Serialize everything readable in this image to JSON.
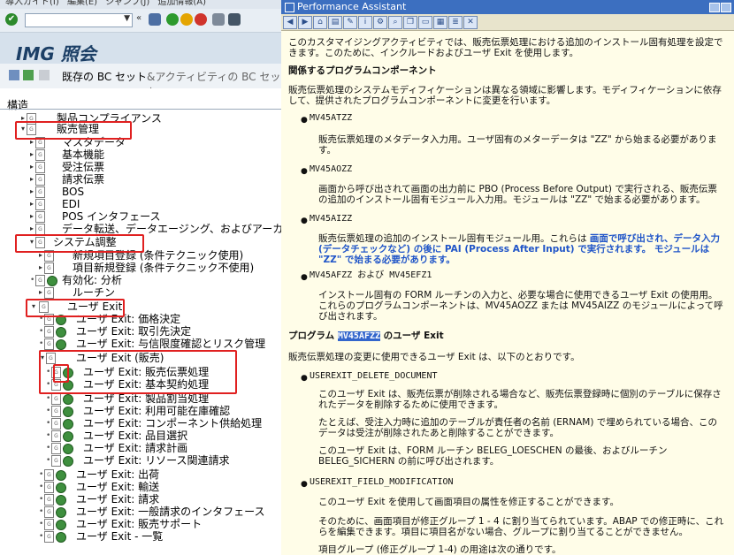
{
  "left_window": {
    "menubar": [
      "導入ガイド(I)",
      "編集(E)",
      "ジャンプ(J)",
      "追加情報(A)"
    ],
    "title": "IMG 照会",
    "toolbar2": {
      "existing_bc_set": "既存の BC セット",
      "activity_bc_set": "&アクティビティの BC セット"
    },
    "tree_header": "構造",
    "tree": [
      {
        "label": "製品コンプライアンス"
      },
      {
        "label": "販売管理"
      },
      {
        "label": "マスタデータ"
      },
      {
        "label": "基本機能"
      },
      {
        "label": "受注伝票"
      },
      {
        "label": "請求伝票"
      },
      {
        "label": "BOS"
      },
      {
        "label": "EDI"
      },
      {
        "label": "POS インタフェース"
      },
      {
        "label": "データ転送、データエージング、およびアーカイブ"
      },
      {
        "label": "システム調整"
      },
      {
        "label": "新規項目登録 (条件テクニック使用)"
      },
      {
        "label": "項目新規登録 (条件テクニック不使用)"
      },
      {
        "label": "有効化: 分析"
      },
      {
        "label": "ルーチン"
      },
      {
        "label": "ユーザ Exit"
      },
      {
        "label": "ユーザ Exit: 価格決定"
      },
      {
        "label": "ユーザ Exit: 取引先決定"
      },
      {
        "label": "ユーザ Exit: 与信限度確認とリスク管理"
      },
      {
        "label": "ユーザ Exit (販売)"
      },
      {
        "label": "ユーザ Exit: 販売伝票処理"
      },
      {
        "label": "ユーザ Exit: 基本契約処理"
      },
      {
        "label": "ユーザ Exit: 製品割当処理"
      },
      {
        "label": "ユーザ Exit: 利用可能在庫確認"
      },
      {
        "label": "ユーザ Exit: コンポーネント供給処理"
      },
      {
        "label": "ユーザ Exit: 品目選択"
      },
      {
        "label": "ユーザ Exit: 請求計画"
      },
      {
        "label": "ユーザ Exit: リソース関連請求"
      },
      {
        "label": "ユーザ Exit: 出荷"
      },
      {
        "label": "ユーザ Exit: 輸送"
      },
      {
        "label": "ユーザ Exit: 請求"
      },
      {
        "label": "ユーザ Exit: 一般請求のインタフェース"
      },
      {
        "label": "ユーザ Exit: 販売サポート"
      },
      {
        "label": "ユーザ Exit - 一覧"
      }
    ]
  },
  "pa": {
    "title": "Performance Assistant",
    "intro": "このカスタマイジングアクティビティでは、販売伝票処理における追加のインストール固有処理を設定できます。このために、インクルードおよびユーザ Exit を使用します。",
    "h1": "関係するプログラムコンポーネント",
    "p1": "販売伝票処理のシステムモディフィケーションは異なる領域に影響します。モディフィケーションに依存して、提供されたプログラムコンポーネントに変更を行います。",
    "items": [
      {
        "name": "MV45ATZZ",
        "text": "販売伝票処理のメタデータ入力用。ユーザ固有のメターデータは \"ZZ\" から始まる必要があります。"
      },
      {
        "name": "MV45AOZZ",
        "text": "画面から呼び出されて画面の出力前に PBO (Process Before Output) で実行される、販売伝票の追加のインストール固有モジュール入力用。モジュールは \"ZZ\" で始まる必要があります。"
      },
      {
        "name": "MV45AIZZ",
        "text_a": "販売伝票処理の追加のインストール固有モジュール用。これらは ",
        "text_b": "画面で呼び出され、データ入力 (データチェックなど) の後に PAI (Process After Input) で実行されます。 モジュールは \"ZZ\" で始まる必要があります。"
      },
      {
        "name": "MV45AFZZ および MV45EFZ1",
        "text": "インストール固有の FORM ルーチンの入力と、必要な場合に使用できるユーザ Exit の使用用。これらのプログラムコンポーネントは、MV45AOZZ または MV45AIZZ のモジュールによって呼び出されます。"
      }
    ],
    "h2_pre": "プログラム ",
    "h2_hl": "MV45AFZZ",
    "h2_post": " のユーザ Exit",
    "p2": "販売伝票処理の変更に使用できるユーザ Exit は、以下のとおりです。",
    "exit1_name": "USEREXIT_DELETE_DOCUMENT",
    "exit1_p1": "このユーザ Exit は、販売伝票が削除される場合など、販売伝票登録時に個別のテーブルに保存されたデータを削除するために使用できます。",
    "exit1_p2": "たとえば、受注入力時に追加のテーブルが責任者の名前 (ERNAM) で埋められている場合、このデータは受注が削除されたあと削除することができます。",
    "exit1_p3": "このユーザ Exit は、FORM ルーチン BELEG_LOESCHEN の最後、およびルーチン BELEG_SICHERN の前に呼び出されます。",
    "exit2_name": "USEREXIT_FIELD_MODIFICATION",
    "exit2_p1": "このユーザ Exit を使用して画面項目の属性を修正することができます。",
    "exit2_p2": "そのために、画面項目が修正グループ 1 - 4 に割り当てられています。ABAP での修正時に、これらを編集できます。項目に項目名がない場合、グループに割り当てることができません。",
    "exit2_p3": "項目グループ (修正グループ 1-4) の用途は次の通りです。"
  },
  "colors": {
    "pa_bg": "#fffde8",
    "pa_title": "#3c6fc0",
    "highlight_box": "#e02020",
    "link": "#2055c8"
  }
}
